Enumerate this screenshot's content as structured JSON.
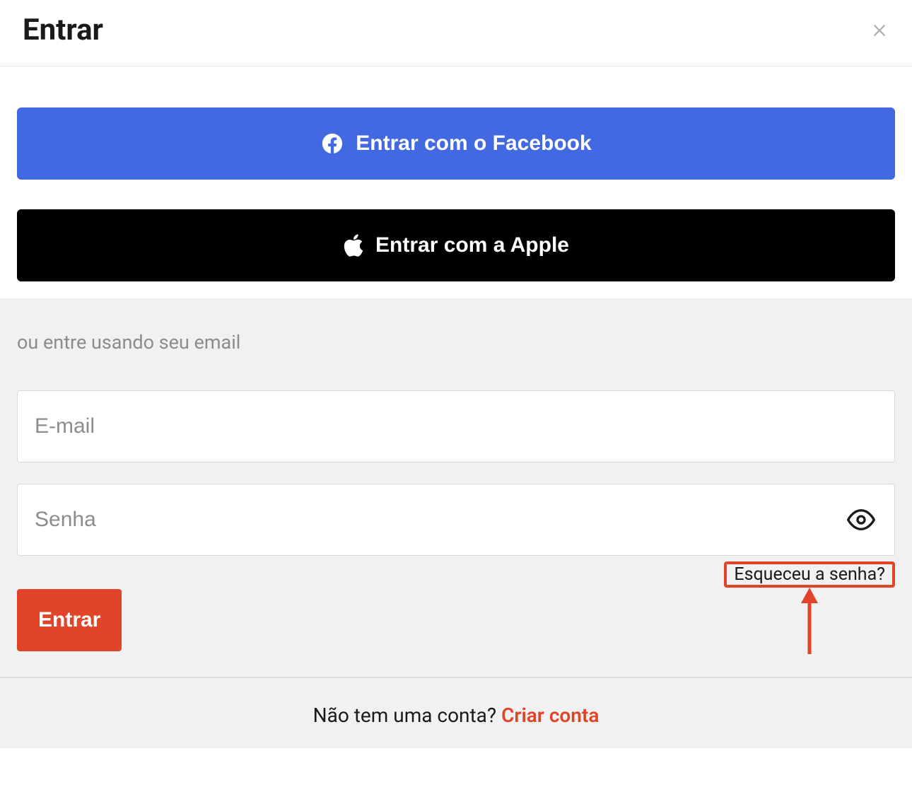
{
  "header": {
    "title": "Entrar"
  },
  "social": {
    "facebook_label": "Entrar com o Facebook",
    "apple_label": "Entrar com a Apple"
  },
  "form": {
    "divider_text": "ou entre usando seu email",
    "email_placeholder": "E-mail",
    "password_placeholder": "Senha",
    "forgot_label": "Esqueceu a senha?",
    "submit_label": "Entrar"
  },
  "footer": {
    "prompt_text": "Não tem uma conta? ",
    "link_label": "Criar conta"
  },
  "colors": {
    "facebook": "#4269e1",
    "apple": "#000000",
    "accent": "#e14529"
  }
}
